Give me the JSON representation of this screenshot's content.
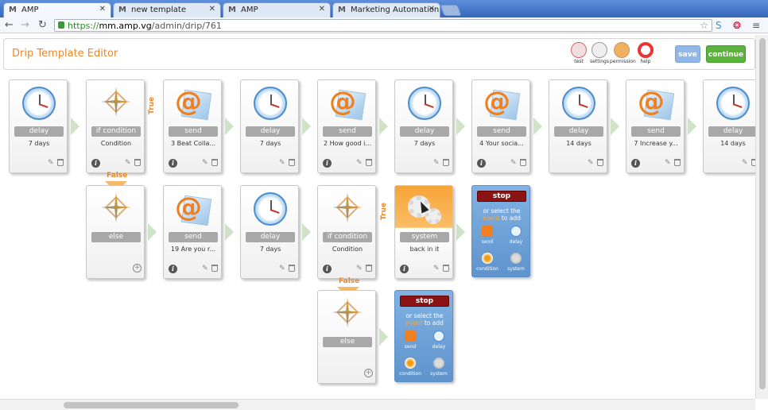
{
  "browser": {
    "tabs": [
      {
        "title": "AMP",
        "active": true
      },
      {
        "title": "new template",
        "active": false
      },
      {
        "title": "AMP",
        "active": false
      },
      {
        "title": "Marketing Automation So",
        "active": false
      }
    ],
    "url_scheme": "https://",
    "url_host": "mm.amp.vg",
    "url_path": "/admin/drip/761"
  },
  "editor": {
    "title": "Drip Template Editor",
    "tools": [
      {
        "label": "test",
        "icon": "flask-icon"
      },
      {
        "label": "settings",
        "icon": "settings-icon"
      },
      {
        "label": "permission",
        "icon": "users-icon"
      },
      {
        "label": "help",
        "icon": "lifebuoy-icon"
      }
    ],
    "save_label": "save",
    "continue_label": "continue"
  },
  "branch_labels": {
    "true": "True",
    "false": "False"
  },
  "row1": [
    {
      "type": "delay",
      "label": "delay",
      "desc": "7 days"
    },
    {
      "type": "condition",
      "label": "if condition",
      "desc": "Condition"
    },
    {
      "type": "send",
      "label": "send",
      "desc": "3 Beat Colla..."
    },
    {
      "type": "delay",
      "label": "delay",
      "desc": "7 days"
    },
    {
      "type": "send",
      "label": "send",
      "desc": "2 How good i..."
    },
    {
      "type": "delay",
      "label": "delay",
      "desc": "7 days"
    },
    {
      "type": "send",
      "label": "send",
      "desc": "4 Your socia..."
    },
    {
      "type": "delay",
      "label": "delay",
      "desc": "14 days"
    },
    {
      "type": "send",
      "label": "send",
      "desc": "7 Increase y..."
    },
    {
      "type": "delay",
      "label": "delay",
      "desc": "14 days"
    }
  ],
  "row2": [
    {
      "type": "else",
      "label": "else",
      "desc": ""
    },
    {
      "type": "send",
      "label": "send",
      "desc": "19 Are you r..."
    },
    {
      "type": "delay",
      "label": "delay",
      "desc": "7 days"
    },
    {
      "type": "condition",
      "label": "if condition",
      "desc": "Condition"
    },
    {
      "type": "system",
      "label": "system",
      "desc": "back in it"
    }
  ],
  "row3": [
    {
      "type": "else",
      "label": "else",
      "desc": ""
    }
  ],
  "stop_panel": {
    "stop_label": "stop",
    "or_text": "or select the",
    "highlight": "event",
    "to_add": "to add",
    "options": [
      "send",
      "delay",
      "condition",
      "system"
    ]
  }
}
